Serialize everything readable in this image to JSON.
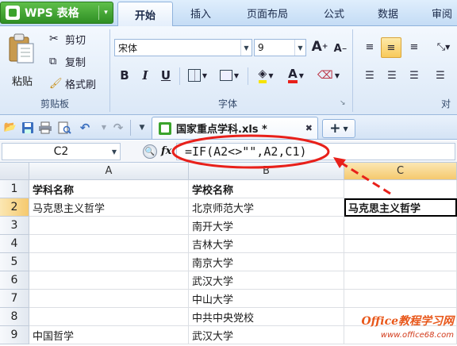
{
  "app": {
    "title": "WPS 表格",
    "menu_arrow": "▾"
  },
  "tabs": [
    {
      "label": "开始",
      "active": true
    },
    {
      "label": "插入"
    },
    {
      "label": "页面布局"
    },
    {
      "label": "公式"
    },
    {
      "label": "数据"
    },
    {
      "label": "审阅"
    }
  ],
  "ribbon": {
    "clipboard": {
      "paste": "粘贴",
      "cut": "剪切",
      "copy": "复制",
      "format_painter": "格式刷",
      "group_label": "剪贴板"
    },
    "font": {
      "font_name": "宋体",
      "font_size": "9",
      "grow_label": "A",
      "shrink_label": "A",
      "bold": "B",
      "italic": "I",
      "underline": "U",
      "font_color_label": "A",
      "group_label": "字体"
    },
    "align": {
      "group_label": "对"
    }
  },
  "document_tab": {
    "label": "国家重点学科.xls *",
    "close": "✖",
    "new_tab": "+"
  },
  "formula_bar": {
    "name_box": "C2",
    "fx": "fx",
    "formula": "=IF(A2<>\"\",A2,C1)"
  },
  "columns": [
    "A",
    "B",
    "C"
  ],
  "rows": [
    {
      "num": "1",
      "a": "学科名称",
      "b": "学校名称",
      "c": ""
    },
    {
      "num": "2",
      "a": "马克思主义哲学",
      "b": "北京师范大学",
      "c": "马克思主义哲学"
    },
    {
      "num": "3",
      "a": "",
      "b": "南开大学",
      "c": ""
    },
    {
      "num": "4",
      "a": "",
      "b": "吉林大学",
      "c": ""
    },
    {
      "num": "5",
      "a": "",
      "b": "南京大学",
      "c": ""
    },
    {
      "num": "6",
      "a": "",
      "b": "武汉大学",
      "c": ""
    },
    {
      "num": "7",
      "a": "",
      "b": "中山大学",
      "c": ""
    },
    {
      "num": "8",
      "a": "",
      "b": "中共中央党校",
      "c": ""
    },
    {
      "num": "9",
      "a": "中国哲学",
      "b": "武汉大学",
      "c": ""
    }
  ],
  "watermark": {
    "line1": "Office教程学习网",
    "line2": "www.office68.com"
  },
  "colors": {
    "accent_red": "#e8201a",
    "wps_green": "#3aa32c",
    "selection": "#000000"
  }
}
